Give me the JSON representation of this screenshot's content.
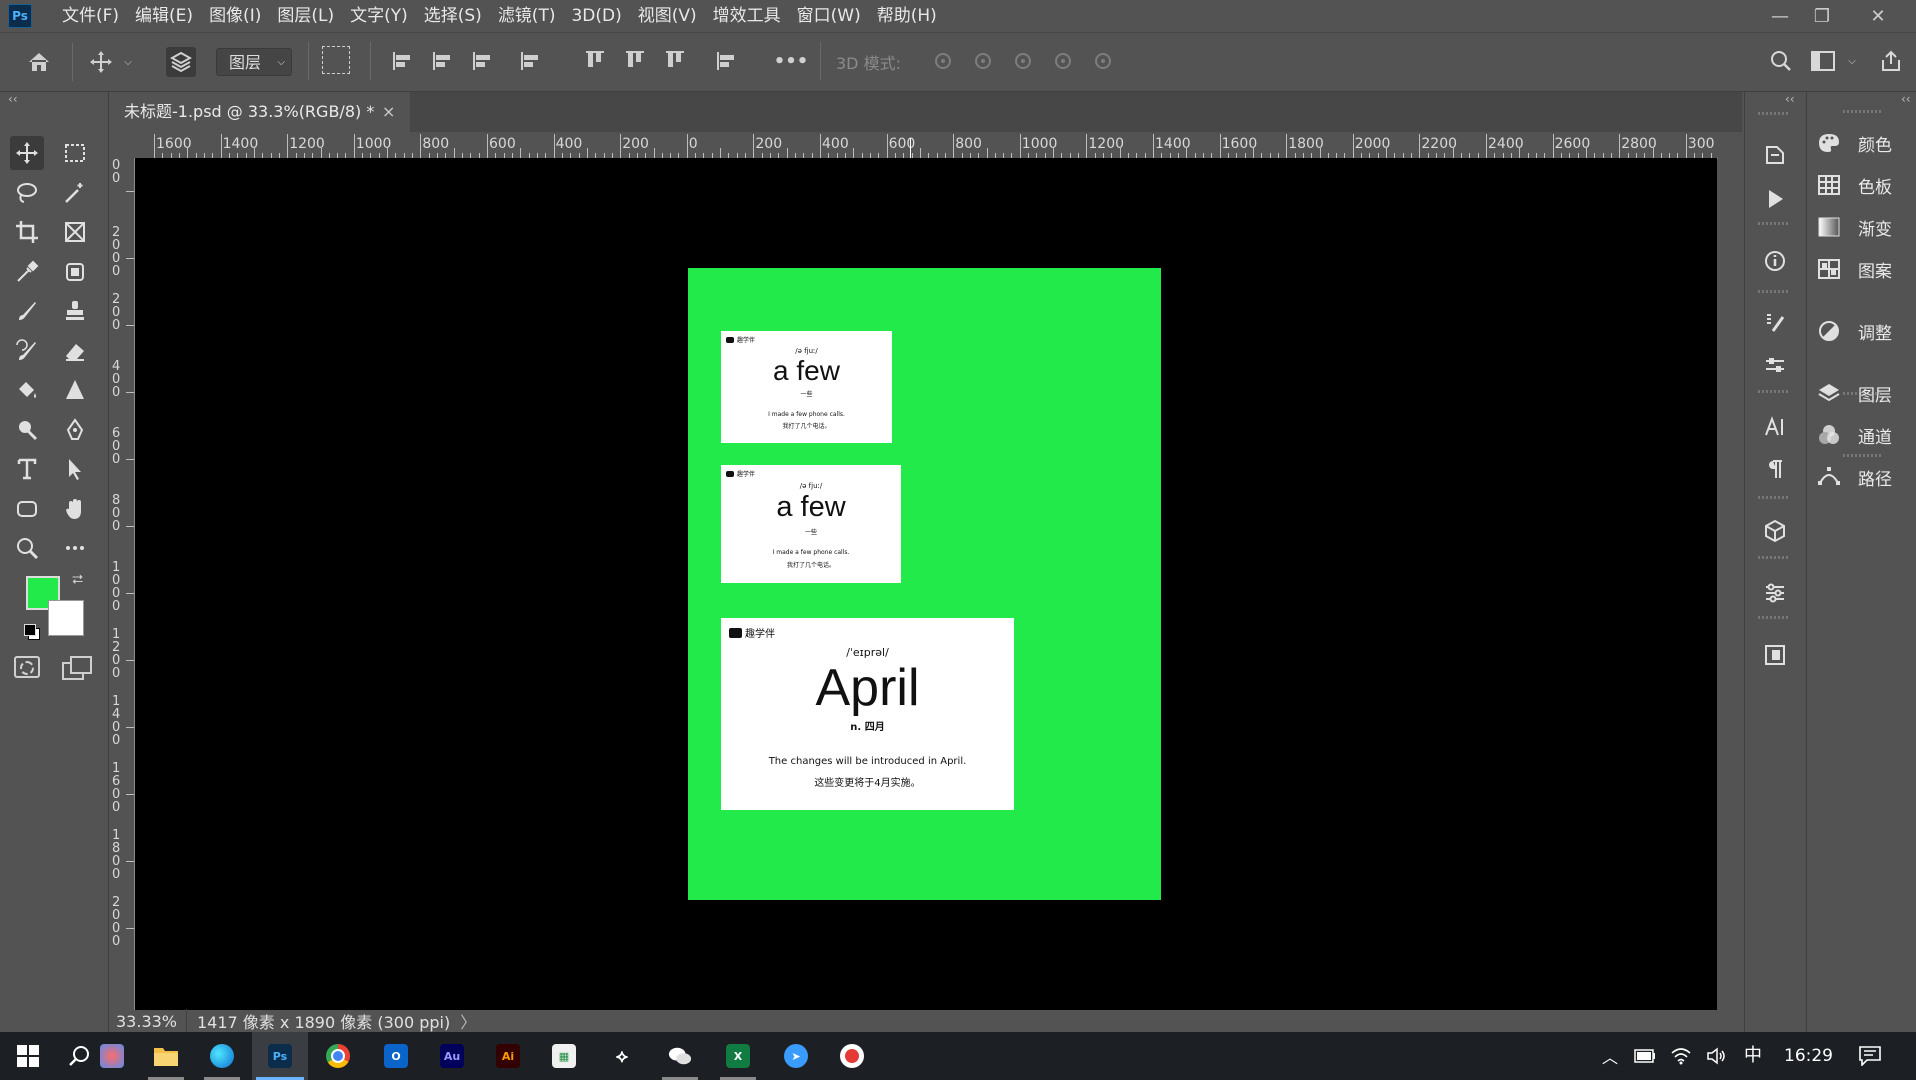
{
  "app": {
    "logo": "Ps"
  },
  "menu": [
    "文件(F)",
    "编辑(E)",
    "图像(I)",
    "图层(L)",
    "文字(Y)",
    "选择(S)",
    "滤镜(T)",
    "3D(D)",
    "视图(V)",
    "增效工具",
    "窗口(W)",
    "帮助(H)"
  ],
  "options": {
    "layer_select": "图层",
    "mode3d_label": "3D 模式:",
    "more": "•••"
  },
  "document": {
    "tab_title": "未标题-1.psd @ 33.3%(RGB/8) *",
    "close_glyph": "×"
  },
  "ruler_top": [
    "1600",
    "1400",
    "1200",
    "1000",
    "800",
    "600",
    "400",
    "200",
    "0",
    "200",
    "400",
    "600",
    "800",
    "1000",
    "1200",
    "1400",
    "1600",
    "1800",
    "2000",
    "2200",
    "2400",
    "2600",
    "2800",
    "300"
  ],
  "ruler_left": [
    "0",
    "0",
    "2",
    "0",
    "0",
    "0",
    "2",
    "0",
    "0",
    "4",
    "0",
    "0",
    "6",
    "0",
    "0",
    "8",
    "0",
    "0",
    "1",
    "0",
    "0",
    "0",
    "1",
    "2",
    "0",
    "0",
    "1",
    "4",
    "0",
    "0",
    "1",
    "6",
    "0",
    "0",
    "1",
    "8",
    "0",
    "0",
    "2",
    "0",
    "0",
    "0"
  ],
  "cards": [
    {
      "brand": "趣学伴",
      "phonetic": "/ə fjuː/",
      "word": "a few",
      "meaning": "一些",
      "example_en": "I made a few phone calls.",
      "example_zh": "我打了几个电话。"
    },
    {
      "brand": "趣学伴",
      "phonetic": "/ə fjuː/",
      "word": "a few",
      "meaning": "一些",
      "example_en": "I made a few phone calls.",
      "example_zh": "我打了几个电话。"
    },
    {
      "brand": "趣学伴",
      "phonetic": "/ˈeɪprəl/",
      "word": "April",
      "meaning": "n. 四月",
      "example_en": "The changes will be introduced in April.",
      "example_zh": "这些变更将于4月实施。"
    }
  ],
  "status": {
    "zoom": "33.33%",
    "doc_size": "1417 像素 x 1890 像素 (300 ppi)",
    "arrow": "〉"
  },
  "panels": [
    {
      "label": "颜色",
      "icon": "palette-icon"
    },
    {
      "label": "色板",
      "icon": "swatches-icon"
    },
    {
      "label": "渐变",
      "icon": "gradient-icon"
    },
    {
      "label": "图案",
      "icon": "pattern-icon"
    },
    {
      "label": "调整",
      "icon": "adjustments-icon"
    },
    {
      "label": "图层",
      "icon": "layers-icon"
    },
    {
      "label": "通道",
      "icon": "channels-icon"
    },
    {
      "label": "路径",
      "icon": "paths-icon"
    }
  ],
  "colors": {
    "foreground": "#22ea4a",
    "background": "#ffffff",
    "artboard": "#22ea4a"
  },
  "taskbar": {
    "ime": "中",
    "time": "16:29"
  }
}
